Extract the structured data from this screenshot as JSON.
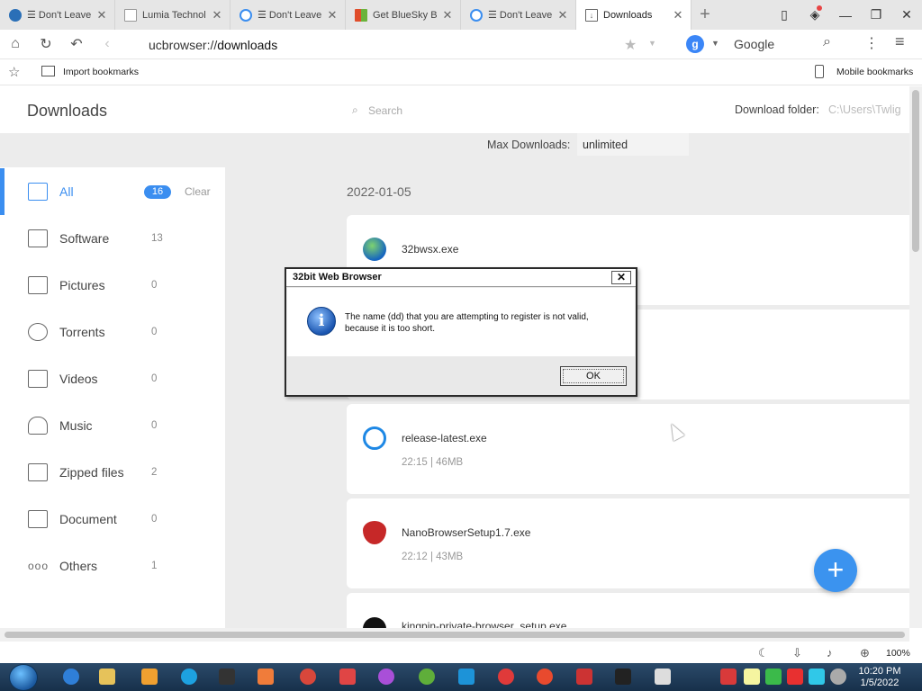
{
  "tabs": [
    {
      "label": "☰ Don't Leave Y",
      "icon": "globe-icon",
      "color": "#2a6fb7",
      "active": false
    },
    {
      "label": "Lumia Technol",
      "icon": "page-icon",
      "color": "#999999",
      "active": false
    },
    {
      "label": "☰ Don't Leave Y",
      "icon": "browser-icon",
      "color": "#3b8ef0",
      "active": false
    },
    {
      "label": "Get BlueSky B",
      "icon": "windows-logo-icon",
      "color": "#e04d2b",
      "active": false
    },
    {
      "label": "☰ Don't Leave Y",
      "icon": "browser-icon",
      "color": "#3b8ef0",
      "active": false
    },
    {
      "label": "Downloads",
      "icon": "download-icon",
      "color": "#666666",
      "active": true
    }
  ],
  "address": {
    "scheme": "ucbrowser://",
    "path": "downloads",
    "search_engine_letter": "g",
    "search_engine": "Google"
  },
  "bookmarks": {
    "import_label": "Import bookmarks",
    "mobile_label": "Mobile bookmarks"
  },
  "downloads": {
    "title": "Downloads",
    "search_placeholder": "Search",
    "folder_label": "Download folder:",
    "folder_value": "C:\\Users\\Twlig",
    "max_label": "Max Downloads:",
    "max_value": "unlimited",
    "clear_label": "Clear"
  },
  "categories": [
    {
      "label": "All",
      "count": "16",
      "icon": "inbox-icon"
    },
    {
      "label": "Software",
      "count": "13",
      "icon": "software-window-icon"
    },
    {
      "label": "Pictures",
      "count": "0",
      "icon": "picture-icon"
    },
    {
      "label": "Torrents",
      "count": "0",
      "icon": "torrent-icon"
    },
    {
      "label": "Videos",
      "count": "0",
      "icon": "video-play-icon"
    },
    {
      "label": "Music",
      "count": "0",
      "icon": "headphones-icon"
    },
    {
      "label": "Zipped files",
      "count": "2",
      "icon": "zip-icon"
    },
    {
      "label": "Document",
      "count": "0",
      "icon": "folder-icon"
    },
    {
      "label": "Others",
      "count": "1",
      "icon": "dots-icon"
    }
  ],
  "date_group": "2022-01-05",
  "files": [
    {
      "name": "32bwsx.exe",
      "meta": "",
      "icon": "globe-icon",
      "color": "#2e7d32"
    },
    {
      "name": "",
      "meta": "",
      "icon": "",
      "color": ""
    },
    {
      "name": "release-latest.exe",
      "meta": "22:15  |  46MB",
      "icon": "robot-icon",
      "color": "#1e88e5"
    },
    {
      "name": "NanoBrowserSetup1.7.exe",
      "meta": "22:12  |  43MB",
      "icon": "heart-n-icon",
      "color": "#c62828"
    },
    {
      "name": "kingpin-private-browser_setup.exe",
      "meta": "",
      "icon": "hat-icon",
      "color": "#111111"
    }
  ],
  "status": {
    "zoom": "100%"
  },
  "taskbar": {
    "time": "10:20 PM",
    "date": "1/5/2022"
  },
  "dialog": {
    "title": "32bit Web Browser",
    "close": "✕",
    "icon_glyph": "i",
    "message": "The name (dd) that you are attempting to register is not valid, because it is too short.",
    "ok_label": "OK"
  },
  "colors": {
    "accent": "#3b8ef0",
    "fab": "#3b93ef"
  }
}
